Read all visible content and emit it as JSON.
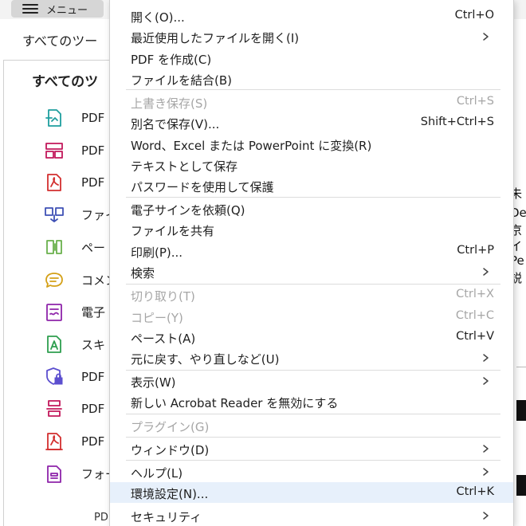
{
  "topbar": {
    "menu_label": "メニュー"
  },
  "tools_panel": {
    "tab_label": "すべてのツー",
    "heading": "すべてのツ",
    "items": [
      {
        "label": "PDF",
        "icon": "pdf-export-icon",
        "color": "#1f9e9e"
      },
      {
        "label": "PDF",
        "icon": "pdf-organize-icon",
        "color": "#c2185b"
      },
      {
        "label": "PDF",
        "icon": "pdf-create-icon",
        "color": "#d32f2f"
      },
      {
        "label": "ファイ",
        "icon": "combine-files-icon",
        "color": "#3f51b5"
      },
      {
        "label": "ペー",
        "icon": "page-tools-icon",
        "color": "#6ab04c"
      },
      {
        "label": "コメン",
        "icon": "comment-icon",
        "color": "#d4a017"
      },
      {
        "label": "電子",
        "icon": "fill-sign-icon",
        "color": "#8e24aa"
      },
      {
        "label": "スキ",
        "icon": "scan-ocr-icon",
        "color": "#2e9e4f"
      },
      {
        "label": "PDF",
        "icon": "protect-pdf-icon",
        "color": "#5c4fcf"
      },
      {
        "label": "PDF",
        "icon": "redact-pdf-icon",
        "color": "#c2185b"
      },
      {
        "label": "PDF",
        "icon": "stamp-pdf-icon",
        "color": "#d32f2f"
      },
      {
        "label": "フォー",
        "icon": "form-icon",
        "color": "#8e24aa"
      }
    ],
    "footer": "PDF"
  },
  "right_peek": [
    "未",
    "De",
    "京",
    "イ",
    "Pe",
    "説"
  ],
  "menu": {
    "items": [
      {
        "id": "open",
        "label": "開く(O)...",
        "shortcut": "Ctrl+O"
      },
      {
        "id": "recent",
        "label": "最近使用したファイルを開く(I)",
        "submenu": true
      },
      {
        "id": "create-pdf",
        "label": "PDF を作成(C)"
      },
      {
        "id": "combine",
        "label": "ファイルを結合(B)"
      },
      {
        "id": "save",
        "label": "上書き保存(S)",
        "shortcut": "Ctrl+S",
        "disabled": true
      },
      {
        "id": "save-as",
        "label": "別名で保存(V)...",
        "shortcut": "Shift+Ctrl+S"
      },
      {
        "id": "convert",
        "label": "Word、Excel または PowerPoint に変換(R)"
      },
      {
        "id": "save-text",
        "label": "テキストとして保存"
      },
      {
        "id": "password",
        "label": "パスワードを使用して保護"
      },
      {
        "id": "request-sign",
        "label": "電子サインを依頼(Q)"
      },
      {
        "id": "share",
        "label": "ファイルを共有"
      },
      {
        "id": "print",
        "label": "印刷(P)...",
        "shortcut": "Ctrl+P"
      },
      {
        "id": "search",
        "label": "検索",
        "submenu": true
      },
      {
        "id": "cut",
        "label": "切り取り(T)",
        "shortcut": "Ctrl+X",
        "disabled": true
      },
      {
        "id": "copy",
        "label": "コピー(Y)",
        "shortcut": "Ctrl+C",
        "disabled": true
      },
      {
        "id": "paste",
        "label": "ペースト(A)",
        "shortcut": "Ctrl+V"
      },
      {
        "id": "undo-redo",
        "label": "元に戻す、やり直しなど(U)",
        "submenu": true
      },
      {
        "id": "view",
        "label": "表示(W)",
        "submenu": true
      },
      {
        "id": "disable-new-reader",
        "label": "新しい Acrobat Reader を無効にする"
      },
      {
        "id": "plugins",
        "label": "プラグイン(G)",
        "disabled": true
      },
      {
        "id": "window",
        "label": "ウィンドウ(D)",
        "submenu": true
      },
      {
        "id": "help",
        "label": "ヘルプ(L)",
        "submenu": true
      },
      {
        "id": "preferences",
        "label": "環境設定(N)...",
        "shortcut": "Ctrl+K",
        "highlighted": true
      },
      {
        "id": "security",
        "label": "セキュリティ",
        "submenu": true
      }
    ]
  }
}
